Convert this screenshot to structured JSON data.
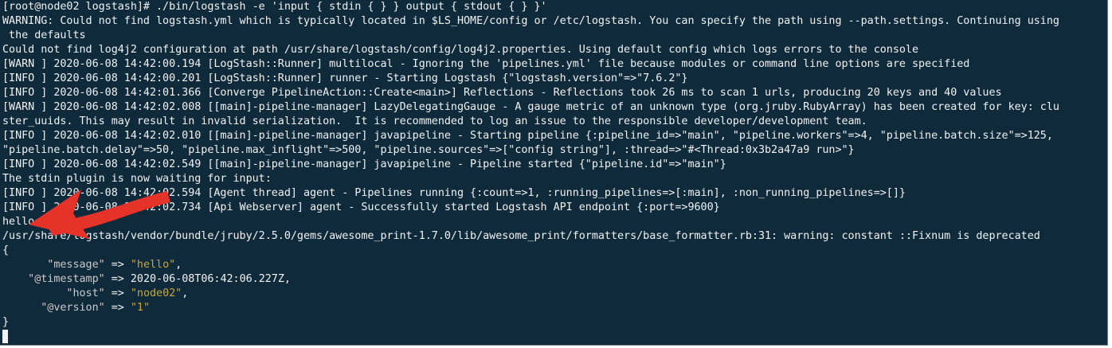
{
  "terminal": {
    "lines": [
      "[root@node02 logstash]# ./bin/logstash -e 'input { stdin { } } output { stdout { } }'",
      "WARNING: Could not find logstash.yml which is typically located in $LS_HOME/config or /etc/logstash. You can specify the path using --path.settings. Continuing using",
      " the defaults",
      "Could not find log4j2 configuration at path /usr/share/logstash/config/log4j2.properties. Using default config which logs errors to the console",
      "[WARN ] 2020-06-08 14:42:00.194 [LogStash::Runner] multilocal - Ignoring the 'pipelines.yml' file because modules or command line options are specified",
      "[INFO ] 2020-06-08 14:42:00.201 [LogStash::Runner] runner - Starting Logstash {\"logstash.version\"=>\"7.6.2\"}",
      "[INFO ] 2020-06-08 14:42:01.366 [Converge PipelineAction::Create<main>] Reflections - Reflections took 26 ms to scan 1 urls, producing 20 keys and 40 values",
      "[WARN ] 2020-06-08 14:42:02.008 [[main]-pipeline-manager] LazyDelegatingGauge - A gauge metric of an unknown type (org.jruby.RubyArray) has been created for key: clu",
      "ster_uuids. This may result in invalid serialization.  It is recommended to log an issue to the responsible developer/development team.",
      "[INFO ] 2020-06-08 14:42:02.010 [[main]-pipeline-manager] javapipeline - Starting pipeline {:pipeline_id=>\"main\", \"pipeline.workers\"=>4, \"pipeline.batch.size\"=>125,",
      "\"pipeline.batch.delay\"=>50, \"pipeline.max_inflight\"=>500, \"pipeline.sources\"=>[\"config string\"], :thread=>\"#<Thread:0x3b2a47a9 run>\"}",
      "[INFO ] 2020-06-08 14:42:02.549 [[main]-pipeline-manager] javapipeline - Pipeline started {\"pipeline.id\"=>\"main\"}",
      "The stdin plugin is now waiting for input:",
      "[INFO ] 2020-06-08 14:42:02.594 [Agent thread] agent - Pipelines running {:count=>1, :running_pipelines=>[:main], :non_running_pipelines=>[]}",
      "[INFO ] 2020-06-08 14:42:02.734 [Api Webserver] agent - Successfully started Logstash API endpoint {:port=>9600}",
      "hello",
      "/usr/share/logstash/vendor/bundle/jruby/2.5.0/gems/awesome_print-1.7.0/lib/awesome_print/formatters/base_formatter.rb:31: warning: constant ::Fixnum is deprecated",
      "{"
    ],
    "output": [
      {
        "indent": "       ",
        "key": "\"message\"",
        "sep": " => ",
        "value": "\"hello\"",
        "tail": ",",
        "quoted": true
      },
      {
        "indent": "    ",
        "key": "\"@timestamp\"",
        "sep": " => ",
        "value": "2020-06-08T06:42:06.227Z",
        "tail": ",",
        "quoted": false
      },
      {
        "indent": "          ",
        "key": "\"host\"",
        "sep": " => ",
        "value": "\"node02\"",
        "tail": ",",
        "quoted": true
      },
      {
        "indent": "      ",
        "key": "\"@version\"",
        "sep": " => ",
        "value": "\"1\"",
        "tail": "",
        "quoted": true
      }
    ],
    "closing": "}",
    "colors": {
      "background": "#0e2a3b",
      "text": "#f2f2f2",
      "string_value": "#c7a63d",
      "annotation_arrow": "#e5332a"
    }
  },
  "annotation": {
    "icon": "red-arrow-pointing-left"
  }
}
